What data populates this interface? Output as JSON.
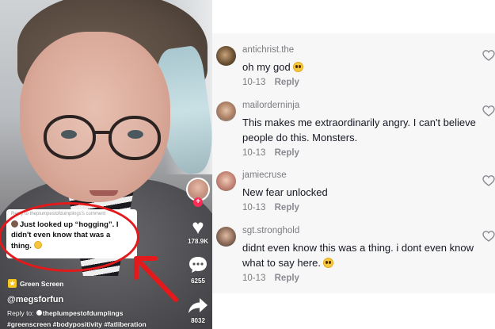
{
  "video": {
    "reply_label": "Reply to theplumpestofdumplings's comment",
    "reply_text": "Just looked up “hogging”. I didn't even know that was a thing.",
    "effect_label": "Green Screen",
    "username": "@megsforfun",
    "reply_to_prefix": "Reply to",
    "reply_to_user": "theplumpestofdumplings",
    "hashtags": "#greenscreen #bodypositivity #fatliberation",
    "like_count": "178.9K",
    "comment_count": "6255",
    "share_count": "8032"
  },
  "comments": [
    {
      "username": "antichrist.the",
      "text": "oh my god",
      "emoji": "pleading-face",
      "date": "10-13",
      "reply_label": "Reply"
    },
    {
      "username": "mailorderninja",
      "text": "This makes me extraordinarily angry. I can't believe people do this. Monsters.",
      "date": "10-13",
      "reply_label": "Reply"
    },
    {
      "username": "jamiecruse",
      "text": "New fear unlocked",
      "date": "10-13",
      "reply_label": "Reply"
    },
    {
      "username": "sgt.stronghold",
      "text": "didnt even know this was a thing. i dont even know what to say here.",
      "emoji": "flushed-face",
      "date": "10-13",
      "reply_label": "Reply"
    }
  ],
  "colors": {
    "highlight_red": "#e3191b",
    "follow_pink": "#fe2c55",
    "comment_panel_bg": "#f7f7f8",
    "meta_gray": "#7c7c80"
  }
}
